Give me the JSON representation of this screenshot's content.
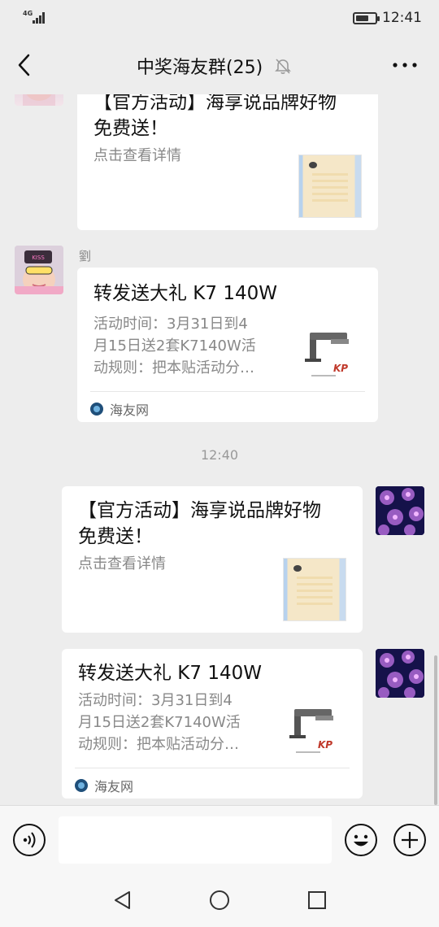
{
  "status_bar": {
    "network": "4G",
    "time": "12:41",
    "battery_level": 0.7
  },
  "header": {
    "title": "中奖海友群(25)",
    "back_icon": "chevron-left-icon",
    "mute_icon": "bell-off-icon",
    "more_icon": "ellipsis-icon"
  },
  "messages": [
    {
      "title_line1": "【官方活动】海享说品牌好物",
      "title_line2": "免费送！",
      "desc": "点击查看详情"
    },
    {
      "sender": "劉",
      "title": "转发送大礼 K7 140W",
      "desc_line1": "活动时间：3月31日到4",
      "desc_line2": "月15日送2套K7140W活",
      "desc_line3": "动规则：把本贴活动分…",
      "source": "海友网"
    },
    {
      "timestamp": "12:40"
    },
    {
      "title_line1": "【官方活动】海享说品牌好物",
      "title_line2": "免费送！",
      "desc": "点击查看详情"
    },
    {
      "title": "转发送大礼 K7 140W",
      "desc_line1": "活动时间：3月31日到4",
      "desc_line2": "月15日送2套K7140W活",
      "desc_line3": "动规则：把本贴活动分…",
      "source": "海友网"
    }
  ],
  "input_bar": {
    "placeholder": "",
    "voice_icon": "voice-icon",
    "emoji_icon": "emoji-icon",
    "plus_icon": "plus-icon"
  },
  "nav_bar": {
    "back_icon": "triangle-back-icon",
    "home_icon": "circle-home-icon",
    "recent_icon": "square-recent-icon"
  }
}
